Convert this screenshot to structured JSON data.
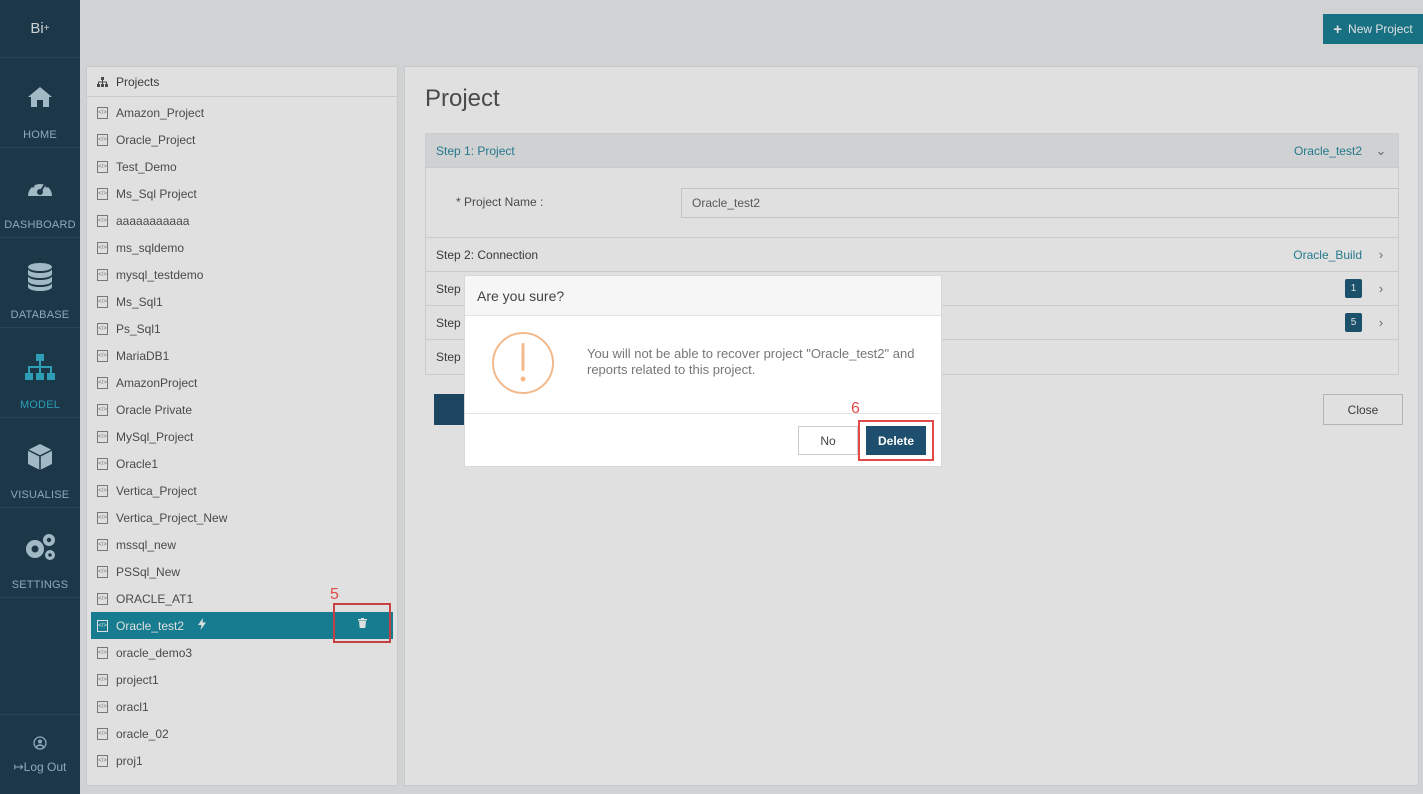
{
  "app": {
    "brand": "Bi",
    "brand_sup": "+"
  },
  "sidebar": {
    "items": [
      {
        "label": "HOME",
        "icon": "home-icon"
      },
      {
        "label": "DASHBOARD",
        "icon": "dashboard-icon"
      },
      {
        "label": "DATABASE",
        "icon": "database-icon"
      },
      {
        "label": "MODEL",
        "icon": "model-icon",
        "active": true
      },
      {
        "label": "VISUALISE",
        "icon": "cube-icon"
      },
      {
        "label": "SETTINGS",
        "icon": "gears-icon"
      }
    ],
    "logout_label": "Log Out"
  },
  "topbar": {
    "new_project_label": "New Project"
  },
  "projects": {
    "header": "Projects",
    "items": [
      "Amazon_Project",
      "Oracle_Project",
      "Test_Demo",
      "Ms_Sql Project",
      "aaaaaaaaaaa",
      "ms_sqldemo",
      "mysql_testdemo",
      "Ms_Sql1",
      "Ps_Sql1",
      "MariaDB1",
      "AmazonProject",
      "Oracle Private",
      "MySql_Project",
      "Oracle1",
      "Vertica_Project",
      "Vertica_Project_New",
      "mssql_new",
      "PSSql_New",
      "ORACLE_AT1",
      "Oracle_test2",
      "oracle_demo3",
      "project1",
      "oracl1",
      "oracle_02",
      "proj1"
    ],
    "selected_index": 19,
    "annotation_5": "5"
  },
  "main": {
    "title": "Project",
    "step1": {
      "label": "Step 1: Project",
      "value": "Oracle_test2"
    },
    "field_label": "* Project Name :",
    "field_value": "Oracle_test2",
    "step2": {
      "label": "Step 2: Connection",
      "value": "Oracle_Build"
    },
    "step3": {
      "label": "Step 3",
      "badge": "1"
    },
    "step4": {
      "label": "Step 4",
      "badge": "5"
    },
    "step5": {
      "label": "Step 5"
    },
    "close_label": "Close"
  },
  "modal": {
    "title": "Are you sure?",
    "message": "You will not be able to recover project \"Oracle_test2\" and reports related to this project.",
    "no_label": "No",
    "delete_label": "Delete",
    "annotation_6": "6"
  },
  "colors": {
    "sidebar": "#1f3f52",
    "accent": "#1b8ea3",
    "highlight": "#e24a4a",
    "warning": "#f3b98a"
  }
}
